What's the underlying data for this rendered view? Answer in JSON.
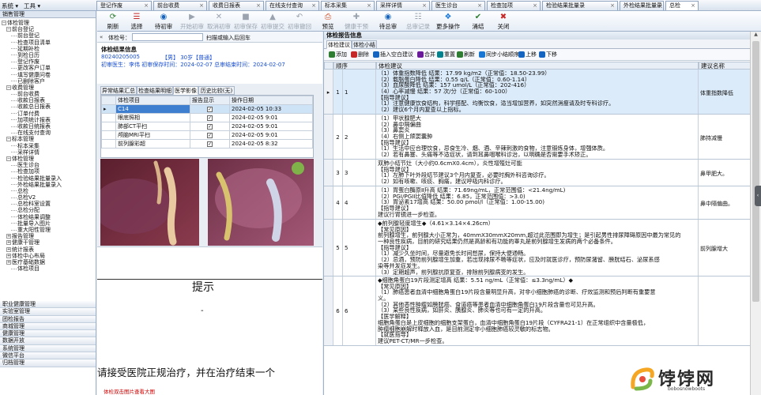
{
  "topbar": {
    "system_menu": "系统",
    "tools_menu": "工具",
    "search_placeholder": ""
  },
  "tabs": [
    {
      "label": "登记作废"
    },
    {
      "label": "前台收费"
    },
    {
      "label": "收费日报表"
    },
    {
      "label": "在线支付查询"
    },
    {
      "label": "标本采集"
    },
    {
      "label": "采样详情"
    },
    {
      "label": "医生诊台"
    },
    {
      "label": "检查加项"
    },
    {
      "label": "检验结果批量录"
    },
    {
      "label": "外检结果批量录"
    },
    {
      "label": "总检"
    }
  ],
  "sidebar": {
    "header": "销售管理",
    "items": [
      {
        "label": "体检管理",
        "sign": "−",
        "indent": 0
      },
      {
        "label": "前台登记",
        "sign": "−",
        "indent": 1
      },
      {
        "label": "前台登记",
        "sign": "",
        "indent": 2
      },
      {
        "label": "检查项目清单",
        "sign": "",
        "indent": 2
      },
      {
        "label": "延期补检",
        "sign": "",
        "indent": 2
      },
      {
        "label": "到检日历",
        "sign": "",
        "indent": 2
      },
      {
        "label": "登记作废",
        "sign": "",
        "indent": 2
      },
      {
        "label": "更改客户订单",
        "sign": "",
        "indent": 2
      },
      {
        "label": "填写健康问卷",
        "sign": "",
        "indent": 2
      },
      {
        "label": "已删除客户",
        "sign": "",
        "indent": 2
      },
      {
        "label": "收费管理",
        "sign": "−",
        "indent": 1
      },
      {
        "label": "前台收费",
        "sign": "",
        "indent": 2
      },
      {
        "label": "收款日报表",
        "sign": "",
        "indent": 2
      },
      {
        "label": "收款总日报表",
        "sign": "",
        "indent": 2
      },
      {
        "label": "订单付费",
        "sign": "",
        "indent": 2
      },
      {
        "label": "加项统计报表",
        "sign": "",
        "indent": 2
      },
      {
        "label": "收款日统报表",
        "sign": "",
        "indent": 2
      },
      {
        "label": "在线支付查询",
        "sign": "",
        "indent": 2
      },
      {
        "label": "标本管理",
        "sign": "−",
        "indent": 1
      },
      {
        "label": "标本采集",
        "sign": "",
        "indent": 2
      },
      {
        "label": "采样详情",
        "sign": "",
        "indent": 2
      },
      {
        "label": "体检管理",
        "sign": "−",
        "indent": 1
      },
      {
        "label": "医生诊台",
        "sign": "",
        "indent": 2
      },
      {
        "label": "检查加项",
        "sign": "",
        "indent": 2
      },
      {
        "label": "检验结果批量录入",
        "sign": "",
        "indent": 2
      },
      {
        "label": "外检结果批量录入",
        "sign": "",
        "indent": 2
      },
      {
        "label": "总检",
        "sign": "",
        "indent": 2
      },
      {
        "label": "总检V2",
        "sign": "",
        "indent": 2
      },
      {
        "label": "总检科室设置",
        "sign": "",
        "indent": 2
      },
      {
        "label": "总检分配",
        "sign": "",
        "indent": 2
      },
      {
        "label": "体检结果调整",
        "sign": "",
        "indent": 2
      },
      {
        "label": "批量导入图片",
        "sign": "",
        "indent": 2
      },
      {
        "label": "重大阳性管理",
        "sign": "",
        "indent": 2
      },
      {
        "label": "报告管理",
        "sign": "+",
        "indent": 1
      },
      {
        "label": "健康干管理",
        "sign": "+",
        "indent": 1
      },
      {
        "label": "统计报表",
        "sign": "+",
        "indent": 1
      },
      {
        "label": "体检中心布局",
        "sign": "+",
        "indent": 1
      },
      {
        "label": "医疗基础数据",
        "sign": "+",
        "indent": 1
      },
      {
        "label": "体检项目",
        "sign": "",
        "indent": 2
      }
    ],
    "nav_buttons": [
      "职业健康管理",
      "实验室管理",
      "团检报告",
      "商城管理",
      "健康管理",
      "数据开放",
      "系统管理",
      "微信平台",
      "归档管理"
    ]
  },
  "toolbar": [
    {
      "label": "刷新",
      "icon": "refresh-icon",
      "glyph": "⟳",
      "color": "#2e7d32",
      "enabled": true
    },
    {
      "label": "选择",
      "icon": "select-icon",
      "glyph": "☰",
      "color": "#c62828",
      "enabled": true
    },
    {
      "label": "待初审",
      "icon": "pending-review-icon",
      "glyph": "◉",
      "color": "#1565c0",
      "enabled": true
    },
    {
      "label": "开始初审",
      "icon": "start-review-icon",
      "glyph": "▶",
      "color": "#9aa3ae",
      "enabled": false
    },
    {
      "label": "取消初审",
      "icon": "cancel-review-icon",
      "glyph": "✕",
      "color": "#9aa3ae",
      "enabled": false
    },
    {
      "label": "初审保存",
      "icon": "save-review-icon",
      "glyph": "■",
      "color": "#9aa3ae",
      "enabled": false
    },
    {
      "label": "初审提交",
      "icon": "submit-review-icon",
      "glyph": "▲",
      "color": "#9aa3ae",
      "enabled": false
    },
    {
      "label": "初审撤回",
      "icon": "withdraw-review-icon",
      "glyph": "↶",
      "color": "#9aa3ae",
      "enabled": false
    },
    {
      "label": "预览",
      "icon": "preview-icon",
      "glyph": "⎙",
      "color": "#d84315",
      "enabled": true
    },
    {
      "label": "健康干预",
      "icon": "health-intervention-icon",
      "glyph": "✚",
      "color": "#9aa3ae",
      "enabled": false
    },
    {
      "label": "待总审",
      "icon": "pending-final-icon",
      "glyph": "◉",
      "color": "#1565c0",
      "enabled": true
    },
    {
      "label": "总审记录",
      "icon": "final-record-icon",
      "glyph": "☷",
      "color": "#9aa3ae",
      "enabled": false
    },
    {
      "label": "更多操作",
      "icon": "more-actions-icon",
      "glyph": "❖",
      "color": "#1976d2",
      "enabled": true
    },
    {
      "label": "涌结",
      "icon": "check-icon",
      "glyph": "✔",
      "color": "#2e7d32",
      "enabled": true
    },
    {
      "label": "关闭",
      "icon": "close-icon",
      "glyph": "✖",
      "color": "#c62828",
      "enabled": true
    }
  ],
  "search": {
    "label": "体检号：",
    "placeholder": "扫描或输入后回车",
    "value": ""
  },
  "exam": {
    "title": "体检结果信息",
    "exam_no": "80240205005",
    "gender_age": "【男】 30岁【普通】",
    "line2": "初审医生：李伟 初审保存时间：2024-02-07  总审结束时间：2024-02-07"
  },
  "subtabs": [
    "异常结果汇总",
    "检查结果明细",
    "医学影像",
    "历史比较(无)"
  ],
  "image_table": {
    "headers": [
      "体检项目",
      "报告显示",
      "操作日期"
    ],
    "rows": [
      {
        "item": "C14",
        "checked": true,
        "date": "2024-02-05 10:33",
        "selected": true
      },
      {
        "item": "眼底照相",
        "checked": true,
        "date": "2024-02-05 9:01",
        "selected": false
      },
      {
        "item": "肺部CT平扫",
        "checked": true,
        "date": "2024-02-05 9:01",
        "selected": false
      },
      {
        "item": "颅脑MRI平扫",
        "checked": true,
        "date": "2024-02-05 9:01",
        "selected": false
      },
      {
        "item": "前列腺彩超",
        "checked": true,
        "date": "2024-02-05 8:32",
        "selected": false
      }
    ]
  },
  "document": {
    "heading": "提示",
    "dash": "-",
    "body": "请接受医院正规治疗，并在治疗结束一个",
    "footer_link": "体检双击图片查看大图"
  },
  "right_panel": {
    "title": "体检报告信息",
    "tabs": [
      "体检建议",
      "体检小结"
    ],
    "tools": [
      {
        "label": "添加",
        "color": "#2e7d32"
      },
      {
        "label": "删除",
        "color": "#c62828"
      },
      {
        "label": "插入空白建议",
        "color": "#1565c0"
      },
      {
        "label": "合并",
        "color": "#6a1b9a"
      },
      {
        "label": "重置",
        "color": "#00838f"
      },
      {
        "label": "刷新",
        "color": "#2e7d32"
      },
      {
        "label": "同步小结顺序",
        "color": "#1976d2"
      },
      {
        "label": "上移",
        "color": "#1565c0"
      },
      {
        "label": "下移",
        "color": "#1565c0"
      }
    ],
    "columns": [
      "顺序",
      "体检建议",
      "建议名称"
    ],
    "rows": [
      {
        "seq": "1",
        "no": "1",
        "name": "体重指数降低",
        "selected": true,
        "lines": [
          "（1）体重指数降低 结果：17.99 kg/m2（正常值：18.50-23.99）",
          "（2）载脂蛋白降低 结果：0.55 g/L（正常值：0.60-1.14）",
          "（3）血尿酸降低 结果：157 umol/L（正常值：202-416）",
          "（4）心率减慢 结果：57 次/分（正常值：60-100）",
          "【指导建议】",
          "（1）注意健康饮食结构，科学搭配、均衡饮食，适当增加营养，如突然消瘦请及时专科诊疗。",
          "（2）建议6个月内复查以上指标。"
        ]
      },
      {
        "seq": "2",
        "no": "2",
        "name": "肺持减慢",
        "selected": false,
        "lines": [
          "（1）甲状腺肥大",
          "（2）鼻中隔偏曲",
          "（3）鼻窦炎",
          "（4）右侧上颌窦囊肿",
          "【指导建议】",
          "（1）生活中应合理饮食，忌食生冷、烟、酒、辛辣刺激的食物，注意锻炼身体，增强体质。",
          "（2）若有鼻塞、头痛等不适症状，请到耳鼻咽喉科诊治，以明确是否需要手术矫正。"
        ]
      },
      {
        "seq": "3",
        "no": "3",
        "name": "鼻甲肥大。",
        "selected": false,
        "lines": [
          "双肺小结节灶（大小约0.6cmX0.4cm），炎性增殖灶可能",
          "【指导建议】",
          "（1）左肺下叶外段结节建议3个月内复查，必要时胸外科咨询诊疗。",
          "（2）如有咳嗽、咳痰、胸痛，建议呼吸内科诊疗。"
        ]
      },
      {
        "seq": "4",
        "no": "4",
        "name": "鼻中隔偏曲。",
        "selected": false,
        "lines": [
          "（1）胃蛋白酶原Ⅱ升高 结果：71.69ng/mL，正常范围值：<21.4ng/mL)",
          "（2）PGI/PGII比值降低 结果：6.85，正常范围值：>3.0)",
          "（3）胃泌素17增高 结果：50.00 pmol/l（正常值：1.00-15.00)",
          "【指导建议】",
          "建议行胃镜进一步检查。"
        ]
      },
      {
        "seq": "5",
        "no": "5",
        "name": "前列腺增大",
        "selected": false,
        "lines": [
          "◆前列腺轻度增生◆（4.61×3.14×4.26cm）",
          "【常见原因】",
          "前列腺增生，前列腺大小正常为，40mmX30mmX20mm,超过此范围即为增生；是引起男性排尿障碍原因中最为常见的",
          "一种良性疾病，目前的研究结果仍然是高龄和有功能的睾丸是前列腺增生发病的两个必备条件。",
          "【指导建议】",
          "（1）减少久坐时间，尽量避免长时间憋尿，保持大便通畅。",
          "（2）忌酒，预防前列腺增生加重，若出现排尿不畅等症状，应及时就医诊疗，预防尿潴留、膀胱结石、泌尿系感",
          "染等并发症发生。",
          "（3）定期超声，前列腺抗原复查，排除前列腺病变的发生。"
        ]
      },
      {
        "seq": "6",
        "no": "6",
        "name": "",
        "selected": false,
        "lines": [
          "◆细胞角蛋白19片段测定增高 结果：5.51 ng/mL（正常值：≤3.3ng/mL）◆",
          "【常见原因】",
          "（1）肺癌患者血清中细胞角蛋白19片段含量明显升高，对非小细胞肺癌的诊断、疗效监测和预后判断有重要意",
          "义。",
          "（2）其他恶性肿瘤如膀胱癌、食道癌等患者血清中细胞角蛋白19片段含量也可见升高。",
          "（3）某些良性疾病，如肝炎、胰腺炎、肺炎等也可有一定的升高。",
          "【医学解释】",
          "细胞角蛋白是上皮细胞的细胞支架蛋白，血清中细胞角蛋白19片段（CYFRA21-1）在正常组织中含量极低，",
          "肿瘤细胞崩解时释放入血，是目前测定非小细胞肺癌较灵敏的标志物。",
          "【就医指导】",
          "建议PET-CT/MR一步检查。"
        ]
      }
    ]
  },
  "watermark": {
    "text": "饽饽网",
    "sub": "bobosnowboots"
  }
}
